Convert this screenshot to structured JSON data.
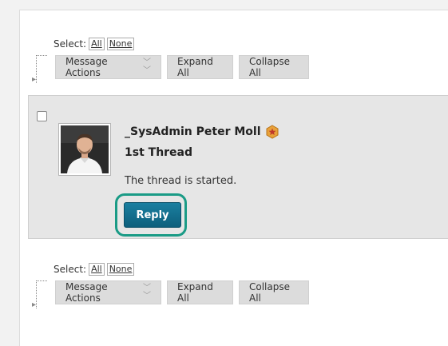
{
  "toolbar_top": {
    "select_label": "Select:",
    "select_all": "All",
    "select_none": "None",
    "message_actions": "Message Actions",
    "expand_all": "Expand All",
    "collapse_all": "Collapse All"
  },
  "message": {
    "author": "_SysAdmin Peter Moll",
    "badge_icon": "star-badge-icon",
    "title": "1st Thread",
    "body": "The thread is started.",
    "reply_label": "Reply",
    "highlight_color": "#1a9b86",
    "reply_color": "#0d6f8e"
  },
  "toolbar_bottom": {
    "select_label": "Select:",
    "select_all": "All",
    "select_none": "None",
    "message_actions": "Message Actions",
    "expand_all": "Expand All",
    "collapse_all": "Collapse All"
  }
}
